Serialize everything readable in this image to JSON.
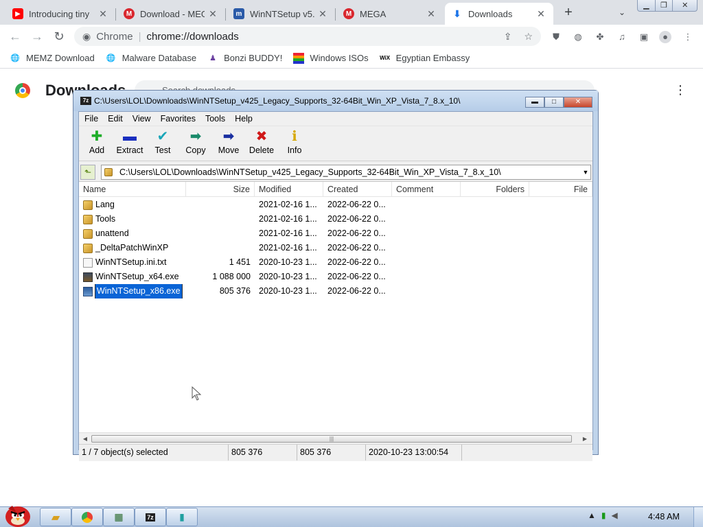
{
  "browser": {
    "tabs": [
      {
        "title": "Introducing tiny",
        "icon": "youtube-icon",
        "color": "#ff0000"
      },
      {
        "title": "Download - MEG",
        "icon": "mega-icon",
        "color": "#d9272e"
      },
      {
        "title": "WinNTSetup v5.",
        "icon": "msfn-icon",
        "color": "#2a5aa8"
      },
      {
        "title": "MEGA",
        "icon": "mega-icon",
        "color": "#d9272e"
      },
      {
        "title": "Downloads",
        "icon": "download-icon",
        "color": "#1a73e8"
      }
    ],
    "omnibox": {
      "site": "Chrome",
      "url": "chrome://downloads"
    },
    "bookmarks": [
      {
        "label": "MEMZ Download",
        "icon": "globe-icon"
      },
      {
        "label": "Malware Database",
        "icon": "globe-icon"
      },
      {
        "label": "Bonzi BUDDY!",
        "icon": "bonzi-icon"
      },
      {
        "label": "Windows ISOs",
        "icon": "windows-flag-icon"
      },
      {
        "label": "Egyptian Embassy",
        "icon": "wix-icon"
      }
    ]
  },
  "downloads_page": {
    "title": "Downloads",
    "search_placeholder": "Search downloads"
  },
  "zip": {
    "title": "C:\\Users\\LOL\\Downloads\\WinNTSetup_v425_Legacy_Supports_32-64Bit_Win_XP_Vista_7_8.x_10\\",
    "app_icon_text": "7z",
    "menu": [
      "File",
      "Edit",
      "View",
      "Favorites",
      "Tools",
      "Help"
    ],
    "toolbar": [
      {
        "label": "Add",
        "icon": "add-icon",
        "glyph": "✚",
        "color": "#1fae2a"
      },
      {
        "label": "Extract",
        "icon": "extract-icon",
        "glyph": "▬",
        "color": "#1a2fbf"
      },
      {
        "label": "Test",
        "icon": "test-icon",
        "glyph": "✔",
        "color": "#1aa6b8"
      },
      {
        "label": "Copy",
        "icon": "copy-icon",
        "glyph": "➡",
        "color": "#1a8a6a"
      },
      {
        "label": "Move",
        "icon": "move-icon",
        "glyph": "➡",
        "color": "#1a2fa0"
      },
      {
        "label": "Delete",
        "icon": "delete-icon",
        "glyph": "✖",
        "color": "#d01818"
      },
      {
        "label": "Info",
        "icon": "info-icon",
        "glyph": "ℹ",
        "color": "#d6a800"
      }
    ],
    "path": "C:\\Users\\LOL\\Downloads\\WinNTSetup_v425_Legacy_Supports_32-64Bit_Win_XP_Vista_7_8.x_10\\",
    "columns": [
      "Name",
      "Size",
      "Modified",
      "Created",
      "Comment",
      "Folders",
      "File"
    ],
    "rows": [
      {
        "name": "Lang",
        "size": "",
        "modified": "2021-02-16 1...",
        "created": "2022-06-22 0...",
        "type": "folder"
      },
      {
        "name": "Tools",
        "size": "",
        "modified": "2021-02-16 1...",
        "created": "2022-06-22 0...",
        "type": "folder"
      },
      {
        "name": "unattend",
        "size": "",
        "modified": "2021-02-16 1...",
        "created": "2022-06-22 0...",
        "type": "folder"
      },
      {
        "name": "_DeltaPatchWinXP",
        "size": "",
        "modified": "2021-02-16 1...",
        "created": "2022-06-22 0...",
        "type": "folder"
      },
      {
        "name": "WinNTSetup.ini.txt",
        "size": "1 451",
        "modified": "2020-10-23 1...",
        "created": "2022-06-22 0...",
        "type": "txt"
      },
      {
        "name": "WinNTSetup_x64.exe",
        "size": "1 088 000",
        "modified": "2020-10-23 1...",
        "created": "2022-06-22 0...",
        "type": "exe1"
      },
      {
        "name": "WinNTSetup_x86.exe",
        "size": "805 376",
        "modified": "2020-10-23 1...",
        "created": "2022-06-22 0...",
        "type": "exe2",
        "selected": true
      }
    ],
    "status": {
      "selection": "1 / 7 object(s) selected",
      "size": "805 376",
      "packed": "805 376",
      "date": "2020-10-23 13:00:54"
    }
  },
  "taskbar": {
    "clock": "4:48 AM"
  }
}
